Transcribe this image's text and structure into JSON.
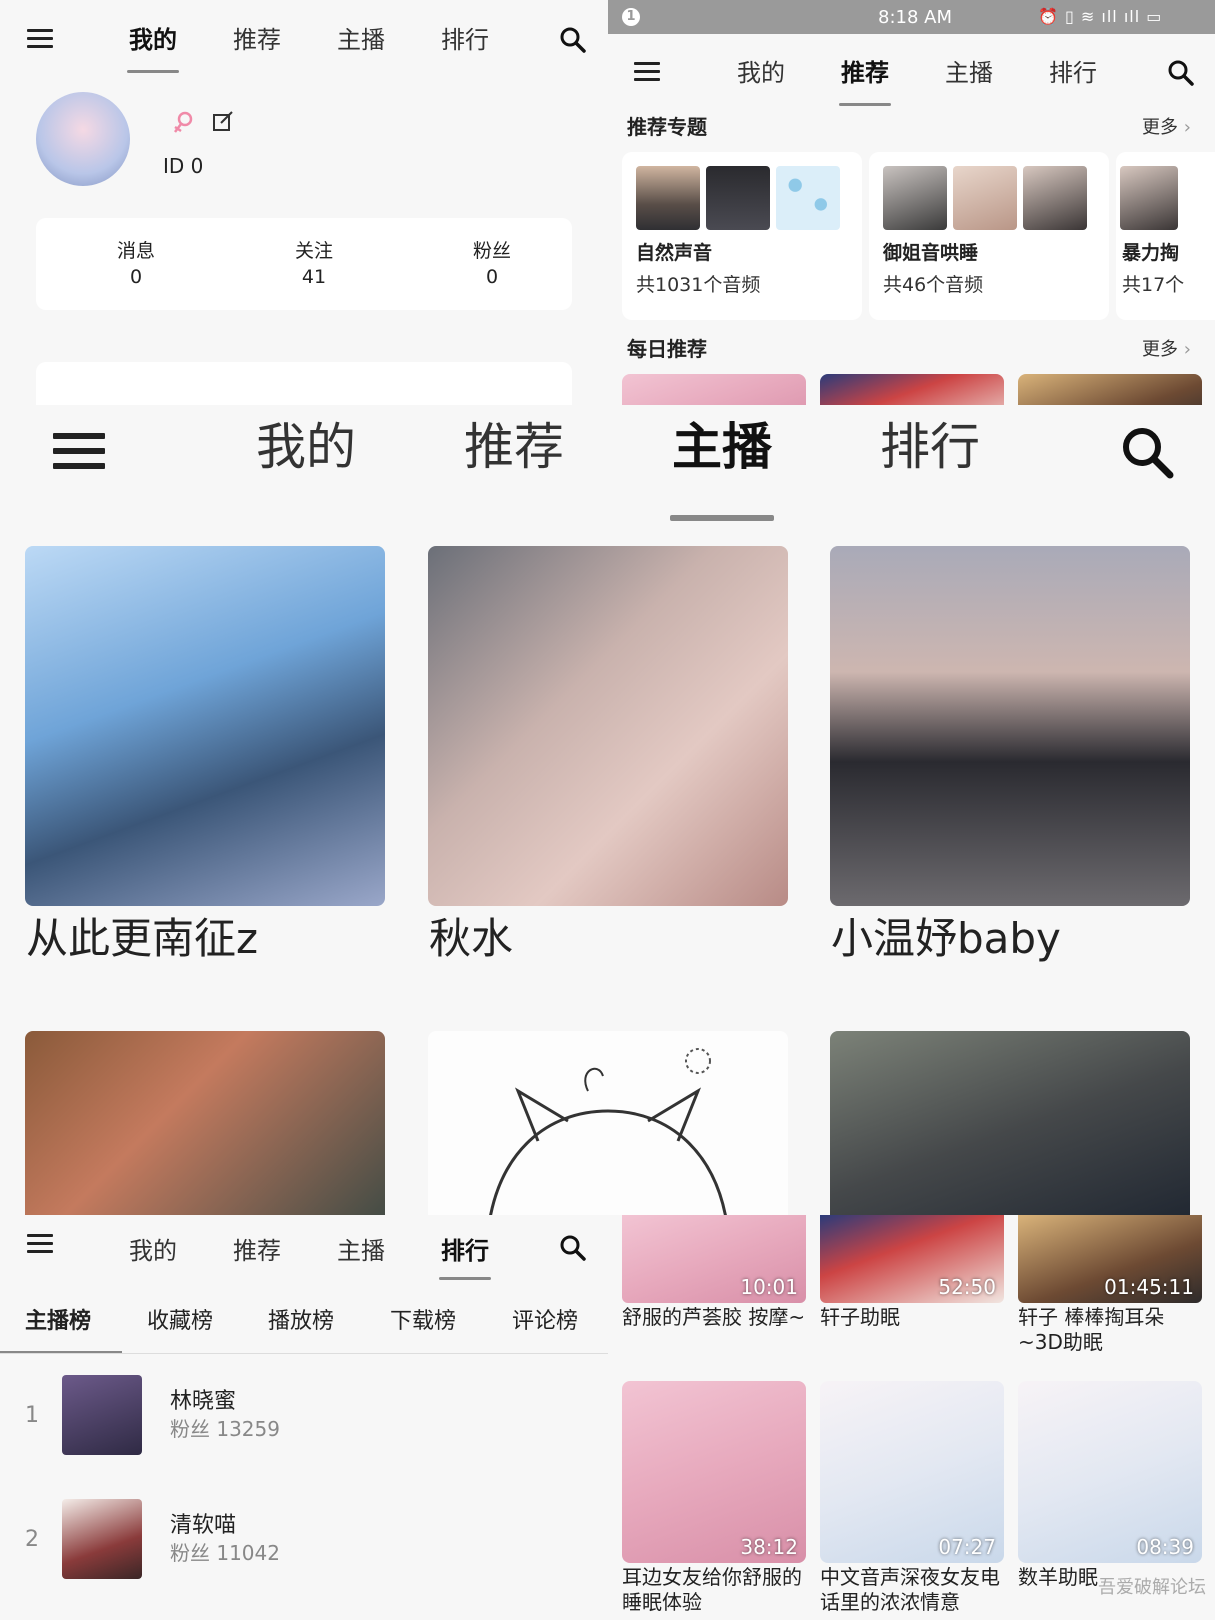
{
  "nav": {
    "menu_icon": "menu-icon",
    "search_icon": "search-icon",
    "tabs": [
      "我的",
      "推荐",
      "主播",
      "排行"
    ]
  },
  "mine": {
    "avatar_icon": "avatar",
    "gender_icon": "female-icon",
    "edit_icon": "edit-icon",
    "id_text": "ID 0",
    "stats": [
      {
        "label": "消息",
        "value": "0"
      },
      {
        "label": "关注",
        "value": "41"
      },
      {
        "label": "粉丝",
        "value": "0"
      }
    ]
  },
  "status_bar": {
    "badge": "1",
    "time": "8:18 AM",
    "icons": "⏰ ▯ ≋ ıll ıll ▭"
  },
  "recommend": {
    "topics_title": "推荐专题",
    "more": "更多",
    "daily_title": "每日推荐",
    "topics": [
      {
        "name": "自然声音",
        "count": "共1031个音频"
      },
      {
        "name": "御姐音哄睡",
        "count": "共46个音频"
      },
      {
        "name": "暴力掏",
        "count": "共17个"
      }
    ]
  },
  "anchors": [
    {
      "name": "从此更南征z"
    },
    {
      "name": "秋水"
    },
    {
      "name": "小温妤baby"
    }
  ],
  "ranking": {
    "sub_tabs": [
      "主播榜",
      "收藏榜",
      "播放榜",
      "下载榜",
      "评论榜"
    ],
    "items": [
      {
        "rank": "1",
        "name": "林晓蜜",
        "fans": "粉丝 13259"
      },
      {
        "rank": "2",
        "name": "清软喵",
        "fans": "粉丝 11042"
      }
    ]
  },
  "daily": [
    {
      "title": "舒服的芦荟胶 按摩~",
      "duration": "10:01"
    },
    {
      "title": "轩子助眠",
      "duration": "52:50"
    },
    {
      "title": "轩子 棒棒掏耳朵~3D助眠",
      "duration": "01:45:11"
    },
    {
      "title": "耳边女友给你舒服的睡眠体验",
      "duration": "38:12"
    },
    {
      "title": "中文音声深夜女友电话里的浓浓情意",
      "duration": "07:27"
    },
    {
      "title": "数羊助眠",
      "duration": "08:39"
    }
  ],
  "watermark": "吾爱破解论坛"
}
